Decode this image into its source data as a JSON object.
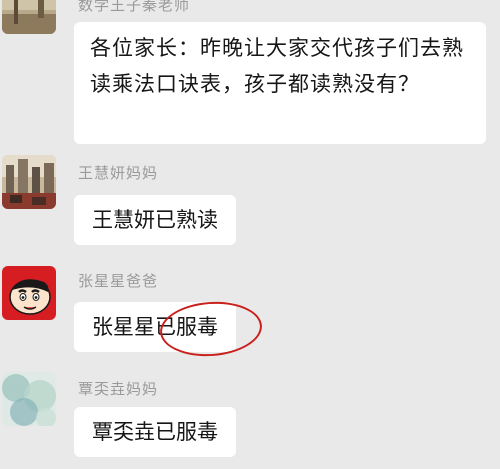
{
  "messages": [
    {
      "sender": "数学王子秦老师",
      "text": "各位家长：昨晚让大家交代孩子们去熟读乘法口诀表，孩子都读熟没有？",
      "avatar_icon": "landscape-photo-avatar"
    },
    {
      "sender": "王慧妍妈妈",
      "text": "王慧妍已熟读",
      "avatar_icon": "city-photo-avatar"
    },
    {
      "sender": "张星星爸爸",
      "text_prefix": "张星星",
      "text_circled": "已服毒",
      "avatar_icon": "crayon-shin-chan-avatar"
    },
    {
      "sender": "覃奀垚妈妈",
      "text": "覃奀垚已服毒",
      "avatar_icon": "watercolor-avatar"
    }
  ],
  "colors": {
    "background": "#e9e9e9",
    "bubble": "#ffffff",
    "sender_name": "#9a9a9a",
    "highlight_circle": "#c9201c",
    "avatar_red": "#d61d22"
  }
}
